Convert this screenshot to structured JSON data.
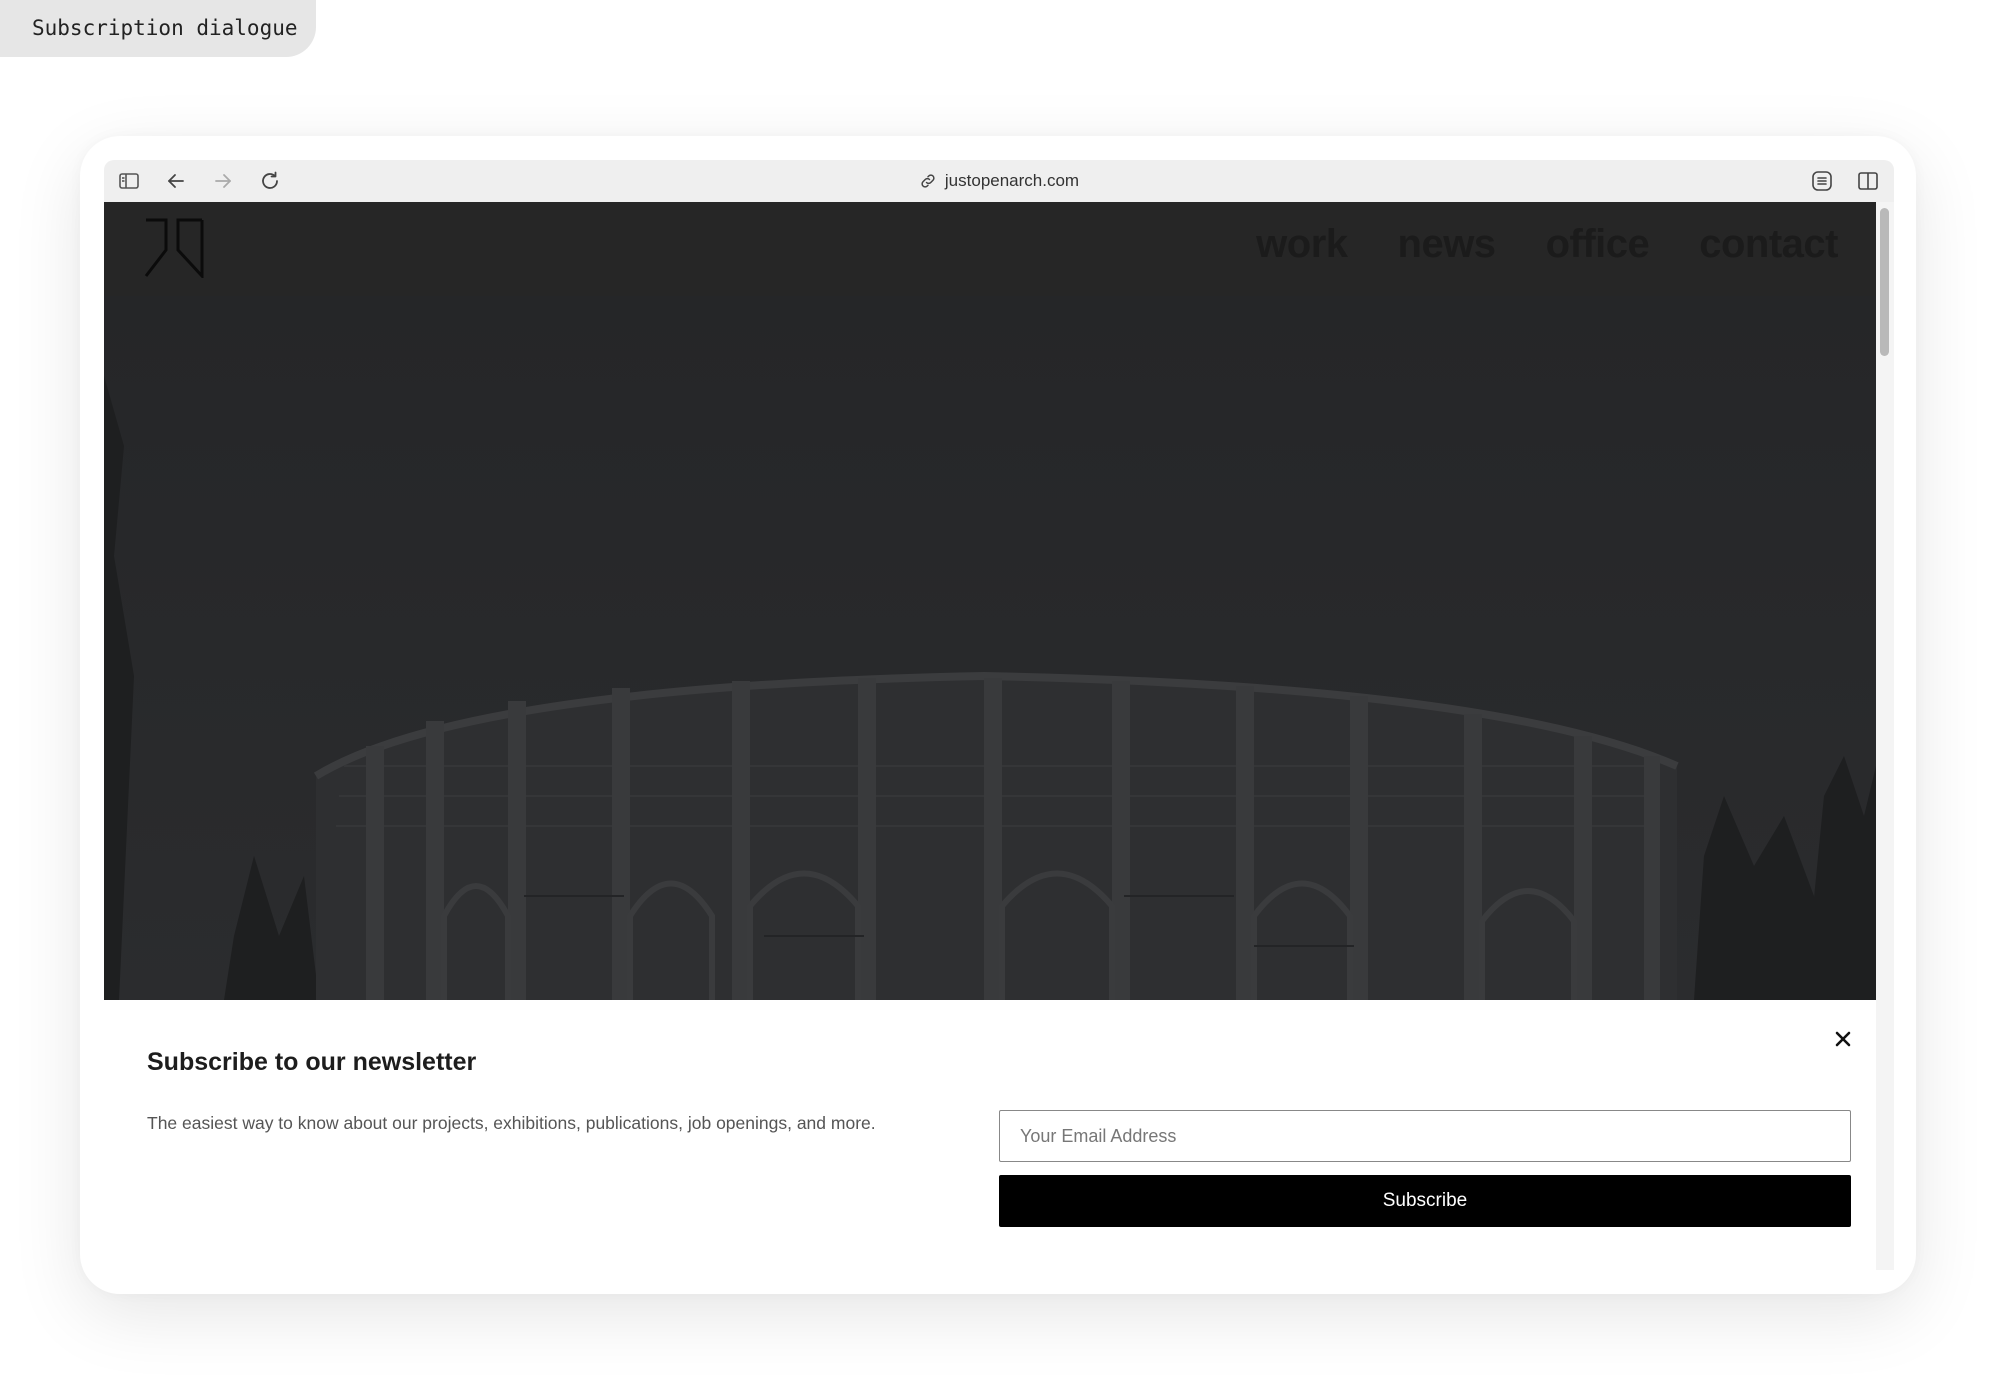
{
  "tag": {
    "label": "Subscription dialogue"
  },
  "browser": {
    "url": "justopenarch.com"
  },
  "site": {
    "nav": [
      {
        "label": "work"
      },
      {
        "label": "news"
      },
      {
        "label": "office"
      },
      {
        "label": "contact"
      }
    ]
  },
  "dialog": {
    "title": "Subscribe to our newsletter",
    "description": "The easiest way to know about our projects, exhibitions, publications, job openings, and more.",
    "email_placeholder": "Your Email Address",
    "email_value": "",
    "submit_label": "Subscribe"
  },
  "colors": {
    "hero_overlay": "#262626",
    "button_bg": "#000000",
    "toolbar_bg": "#efefef"
  },
  "icons": {
    "sidebar": "sidebar-icon",
    "back": "arrow-left-icon",
    "forward": "arrow-right-icon",
    "reload": "reload-icon",
    "link": "link-icon",
    "reader": "reader-icon",
    "split_view": "split-view-icon",
    "close": "close-icon"
  }
}
